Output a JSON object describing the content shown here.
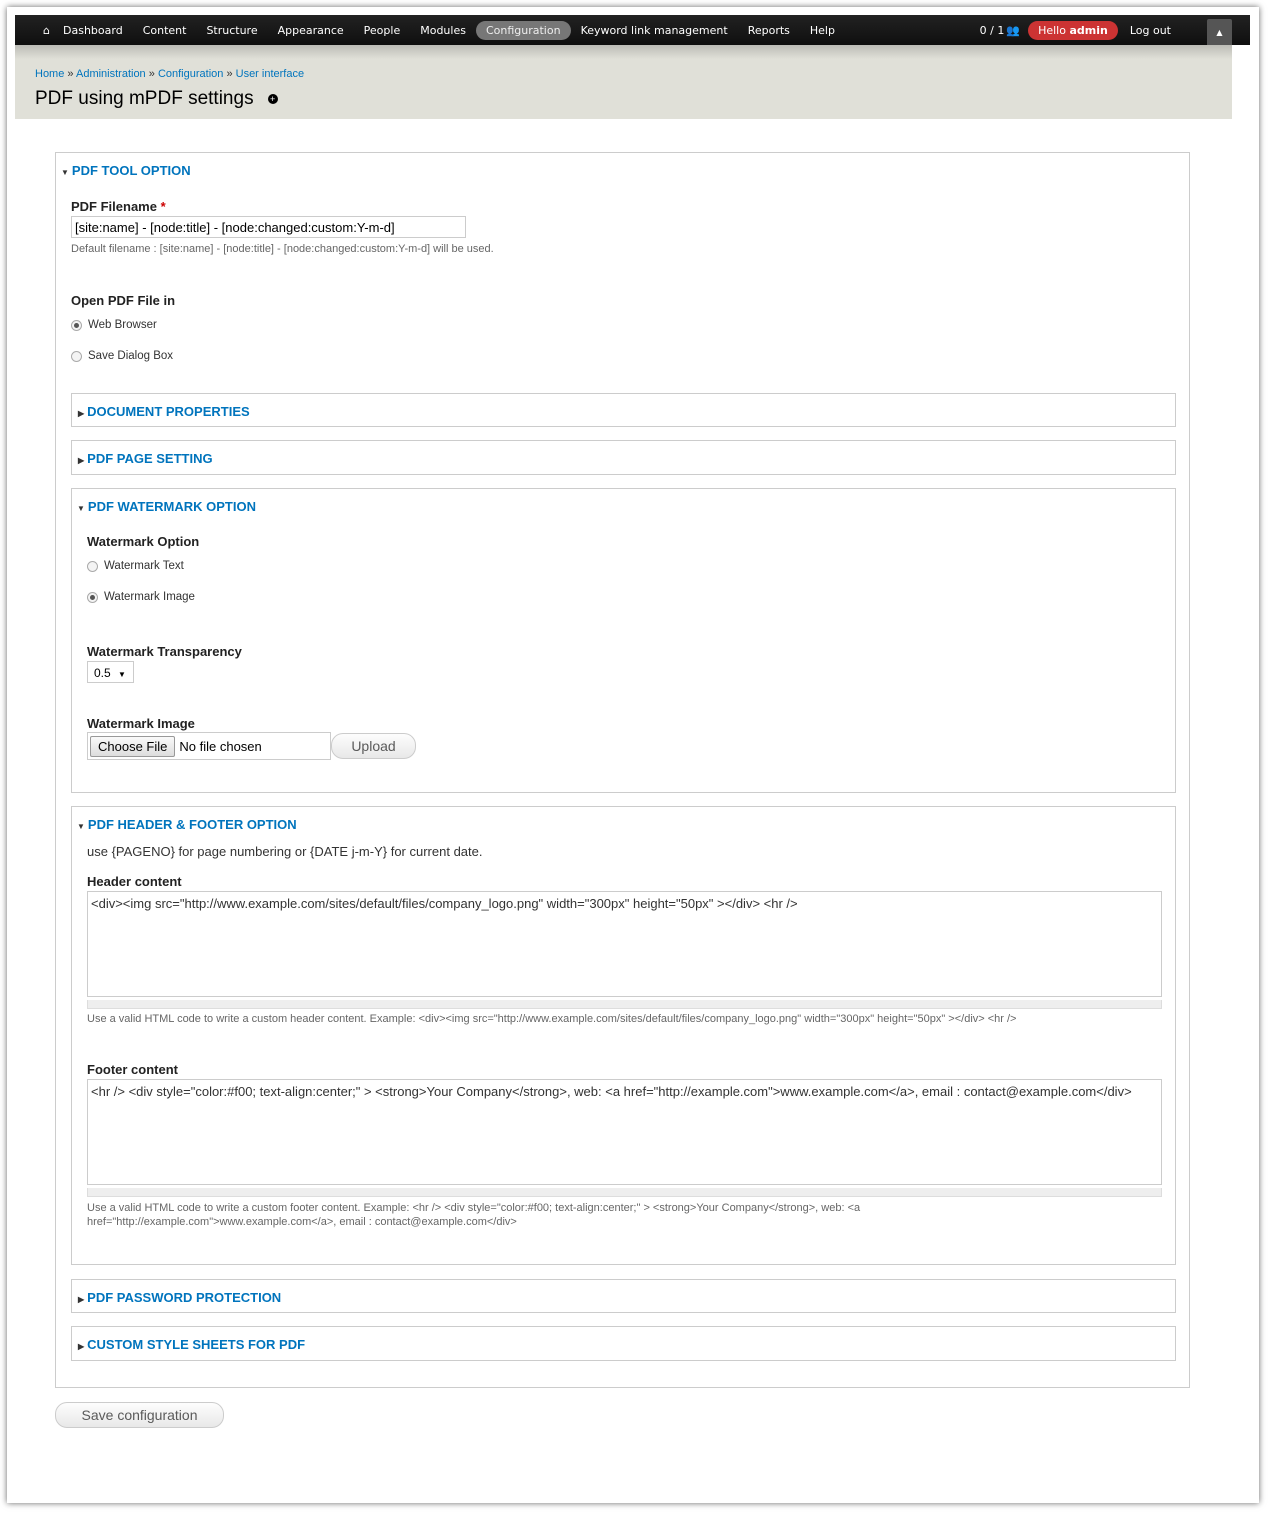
{
  "toolbar": {
    "home_icon": "home-icon",
    "items": [
      "Dashboard",
      "Content",
      "Structure",
      "Appearance",
      "People",
      "Modules",
      "Configuration",
      "Keyword link management",
      "Reports",
      "Help"
    ],
    "active": "Configuration",
    "users_count": "0 / 1",
    "hello": "Hello",
    "user": "admin",
    "logout": "Log out"
  },
  "breadcrumb": [
    "Home",
    "Administration",
    "Configuration",
    "User interface"
  ],
  "breadcrumb_sep": "»",
  "title": "PDF using mPDF settings",
  "tool": {
    "legend": "PDF TOOL OPTION",
    "filename_label": "PDF Filename",
    "required": "*",
    "filename_value": "[site:name] - [node:title] - [node:changed:custom:Y-m-d]",
    "filename_desc": "Default filename : [site:name] - [node:title] - [node:changed:custom:Y-m-d] will be used.",
    "open_label": "Open PDF File in",
    "open_options": [
      "Web Browser",
      "Save Dialog Box"
    ],
    "open_selected": "Web Browser"
  },
  "doc_props": "DOCUMENT PROPERTIES",
  "page_setting": "PDF PAGE SETTING",
  "watermark": {
    "legend": "PDF WATERMARK OPTION",
    "option_label": "Watermark Option",
    "options": [
      "Watermark Text",
      "Watermark Image"
    ],
    "selected": "Watermark Image",
    "transparency_label": "Watermark Transparency",
    "transparency_value": "0.5",
    "image_label": "Watermark Image",
    "choose": "Choose File",
    "no_file": "No file chosen",
    "upload": "Upload"
  },
  "hf": {
    "legend": "PDF HEADER & FOOTER OPTION",
    "note": "use {PAGENO} for page numbering or {DATE j-m-Y} for current date.",
    "header_label": "Header content",
    "header_value": "<div><img src=\"http://www.example.com/sites/default/files/company_logo.png\" width=\"300px\" height=\"50px\" ></div> <hr />",
    "header_desc": "Use a valid HTML code to write a custom header content. Example: <div><img src=\"http://www.example.com/sites/default/files/company_logo.png\" width=\"300px\" height=\"50px\" ></div> <hr />",
    "footer_label": "Footer content",
    "footer_value": "<hr /> <div style=\"color:#f00; text-align:center;\" > <strong>Your Company</strong>, web: <a href=\"http://example.com\">www.example.com</a>, email : contact@example.com</div>",
    "footer_desc": "Use a valid HTML code to write a custom footer content. Example: <hr /> <div style=\"color:#f00; text-align:center;\" > <strong>Your Company</strong>, web: <a href=\"http://example.com\">www.example.com</a>, email : contact@example.com</div>"
  },
  "password": "PDF PASSWORD PROTECTION",
  "css": "CUSTOM STYLE SHEETS FOR PDF",
  "save": "Save configuration",
  "colors": {
    "link": "#0074bd",
    "hello_badge": "#cc3333",
    "toolbar": "#111111",
    "header_bg": "#e0e0d8"
  }
}
